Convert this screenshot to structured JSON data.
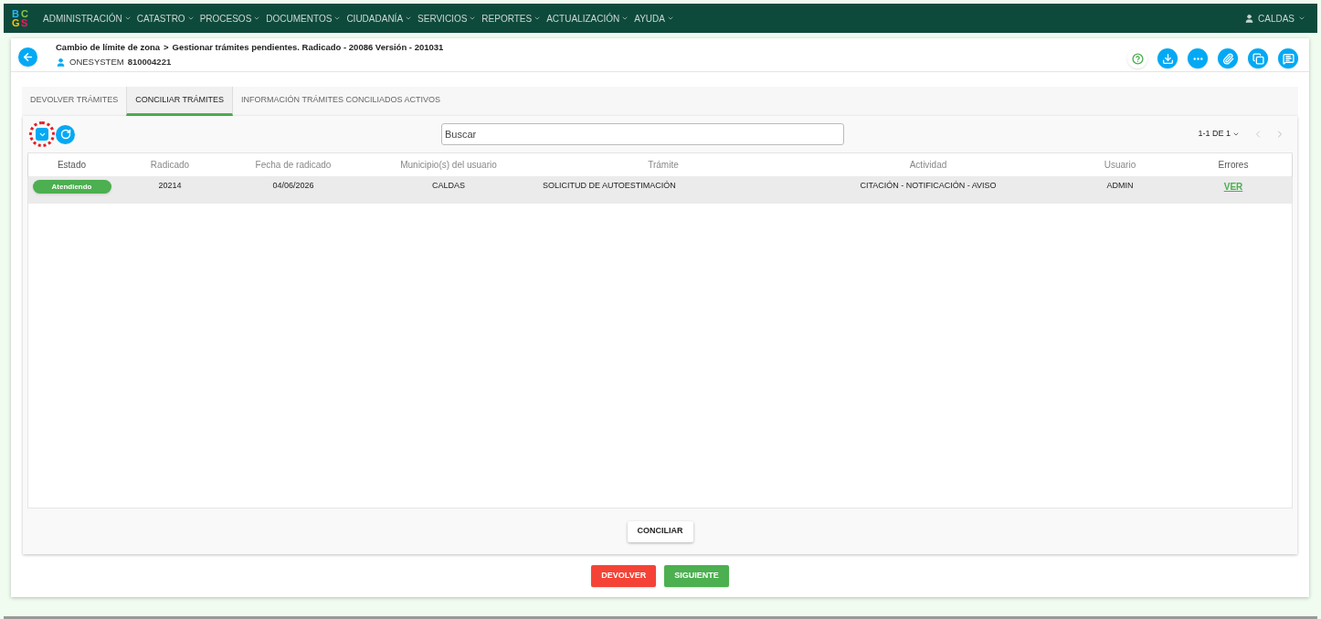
{
  "navbar": {
    "logo": [
      {
        "letter": "B",
        "color": "#29b6f6"
      },
      {
        "letter": "C",
        "color": "#8bc34a"
      },
      {
        "letter": "G",
        "color": "#ffc107"
      },
      {
        "letter": "S",
        "color": "#e91e63"
      }
    ],
    "menu": [
      "ADMINISTRACIÓN",
      "CATASTRO",
      "PROCESOS",
      "DOCUMENTOS",
      "CIUDADANÍA",
      "SERVICIOS",
      "REPORTES",
      "ACTUALIZACIÓN",
      "AYUDA"
    ],
    "user": "CALDAS"
  },
  "header": {
    "breadcrumb": [
      "Cambio de límite de zona",
      "Gestionar trámites pendientes. Radicado - 20086 Versión - 201031"
    ],
    "separator": ">",
    "user_name": "ONESYSTEM",
    "user_id": "810004221",
    "actions": [
      {
        "kind": "help"
      },
      {
        "kind": "download"
      },
      {
        "kind": "flow"
      },
      {
        "kind": "attach"
      },
      {
        "kind": "copy"
      },
      {
        "kind": "notes"
      }
    ]
  },
  "tabs": [
    {
      "label": "DEVOLVER TRÁMITES",
      "selected": false
    },
    {
      "label": "CONCILIAR TRÁMITES",
      "selected": true
    },
    {
      "label": "INFORMACIÓN TRÁMITES CONCILIADOS ACTIVOS",
      "selected": false
    }
  ],
  "toolbar": {
    "highlighted": true,
    "search": {
      "placeholder": "Buscar"
    },
    "pagination": "1-1 DE 1"
  },
  "table": {
    "columns": [
      "Estado",
      "Radicado",
      "Fecha de radicado",
      "Municipio(s) del usuario",
      "Trámite",
      "Actividad",
      "Usuario",
      "Errores"
    ],
    "rows": [
      {
        "selected": true,
        "cells": [
          {
            "kind": "badge",
            "text": "Atendiendo",
            "color": "#4caf50"
          },
          {
            "kind": "text",
            "text": "20214"
          },
          {
            "kind": "text",
            "text": "04/06/2026"
          },
          {
            "kind": "text",
            "text": "CALDAS"
          },
          {
            "kind": "text",
            "text": "SOLICITUD DE AUTOESTIMACIÓN"
          },
          {
            "kind": "text",
            "text": "CITACIÓN - NOTIFICACIÓN - AVISO"
          },
          {
            "kind": "text",
            "text": "ADMIN"
          },
          {
            "kind": "link",
            "text": "VER"
          }
        ]
      }
    ]
  },
  "panel_button": "CONCILIAR",
  "footer_buttons": [
    {
      "label": "DEVOLVER",
      "kind": "danger"
    },
    {
      "label": "SIGUIENTE",
      "kind": "success"
    }
  ]
}
